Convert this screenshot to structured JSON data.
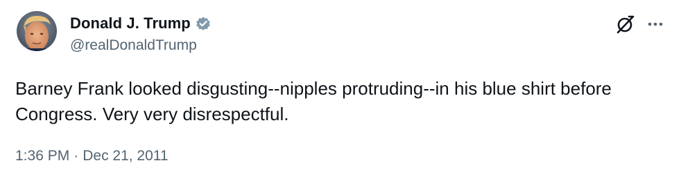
{
  "author": {
    "display_name": "Donald J. Trump",
    "handle": "@realDonaldTrump",
    "verified": true,
    "verified_color": "#829aab",
    "avatar_icon": "profile-photo"
  },
  "actions": {
    "grok_icon": "grok-icon",
    "more_icon": "more-options-icon"
  },
  "tweet": {
    "text": "Barney Frank looked disgusting--nipples protruding--in his blue shirt before Congress. Very very disrespectful.",
    "time": "1:36 PM",
    "separator": "·",
    "date": "Dec 21, 2011"
  },
  "colors": {
    "text": "#0f1419",
    "secondary": "#536471",
    "background": "#ffffff"
  }
}
